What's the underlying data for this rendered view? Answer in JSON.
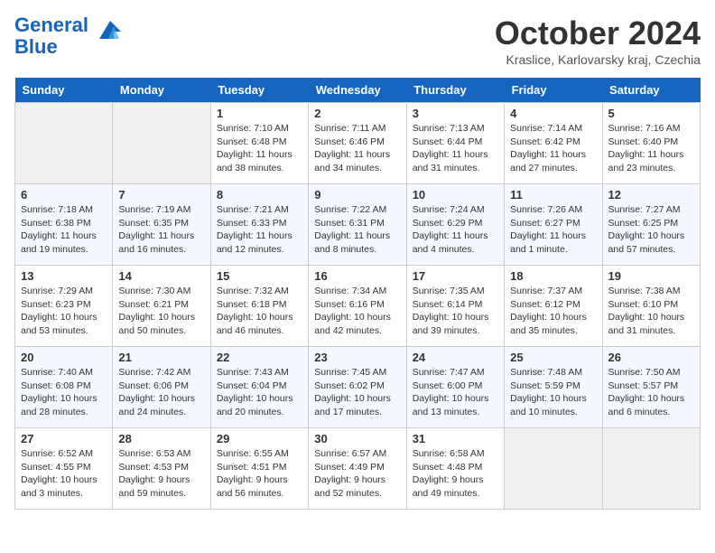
{
  "header": {
    "logo_line1": "General",
    "logo_line2": "Blue",
    "month": "October 2024",
    "location": "Kraslice, Karlovarsky kraj, Czechia"
  },
  "weekdays": [
    "Sunday",
    "Monday",
    "Tuesday",
    "Wednesday",
    "Thursday",
    "Friday",
    "Saturday"
  ],
  "weeks": [
    [
      {
        "day": "",
        "sunrise": "",
        "sunset": "",
        "daylight": ""
      },
      {
        "day": "",
        "sunrise": "",
        "sunset": "",
        "daylight": ""
      },
      {
        "day": "1",
        "sunrise": "Sunrise: 7:10 AM",
        "sunset": "Sunset: 6:48 PM",
        "daylight": "Daylight: 11 hours and 38 minutes."
      },
      {
        "day": "2",
        "sunrise": "Sunrise: 7:11 AM",
        "sunset": "Sunset: 6:46 PM",
        "daylight": "Daylight: 11 hours and 34 minutes."
      },
      {
        "day": "3",
        "sunrise": "Sunrise: 7:13 AM",
        "sunset": "Sunset: 6:44 PM",
        "daylight": "Daylight: 11 hours and 31 minutes."
      },
      {
        "day": "4",
        "sunrise": "Sunrise: 7:14 AM",
        "sunset": "Sunset: 6:42 PM",
        "daylight": "Daylight: 11 hours and 27 minutes."
      },
      {
        "day": "5",
        "sunrise": "Sunrise: 7:16 AM",
        "sunset": "Sunset: 6:40 PM",
        "daylight": "Daylight: 11 hours and 23 minutes."
      }
    ],
    [
      {
        "day": "6",
        "sunrise": "Sunrise: 7:18 AM",
        "sunset": "Sunset: 6:38 PM",
        "daylight": "Daylight: 11 hours and 19 minutes."
      },
      {
        "day": "7",
        "sunrise": "Sunrise: 7:19 AM",
        "sunset": "Sunset: 6:35 PM",
        "daylight": "Daylight: 11 hours and 16 minutes."
      },
      {
        "day": "8",
        "sunrise": "Sunrise: 7:21 AM",
        "sunset": "Sunset: 6:33 PM",
        "daylight": "Daylight: 11 hours and 12 minutes."
      },
      {
        "day": "9",
        "sunrise": "Sunrise: 7:22 AM",
        "sunset": "Sunset: 6:31 PM",
        "daylight": "Daylight: 11 hours and 8 minutes."
      },
      {
        "day": "10",
        "sunrise": "Sunrise: 7:24 AM",
        "sunset": "Sunset: 6:29 PM",
        "daylight": "Daylight: 11 hours and 4 minutes."
      },
      {
        "day": "11",
        "sunrise": "Sunrise: 7:26 AM",
        "sunset": "Sunset: 6:27 PM",
        "daylight": "Daylight: 11 hours and 1 minute."
      },
      {
        "day": "12",
        "sunrise": "Sunrise: 7:27 AM",
        "sunset": "Sunset: 6:25 PM",
        "daylight": "Daylight: 10 hours and 57 minutes."
      }
    ],
    [
      {
        "day": "13",
        "sunrise": "Sunrise: 7:29 AM",
        "sunset": "Sunset: 6:23 PM",
        "daylight": "Daylight: 10 hours and 53 minutes."
      },
      {
        "day": "14",
        "sunrise": "Sunrise: 7:30 AM",
        "sunset": "Sunset: 6:21 PM",
        "daylight": "Daylight: 10 hours and 50 minutes."
      },
      {
        "day": "15",
        "sunrise": "Sunrise: 7:32 AM",
        "sunset": "Sunset: 6:18 PM",
        "daylight": "Daylight: 10 hours and 46 minutes."
      },
      {
        "day": "16",
        "sunrise": "Sunrise: 7:34 AM",
        "sunset": "Sunset: 6:16 PM",
        "daylight": "Daylight: 10 hours and 42 minutes."
      },
      {
        "day": "17",
        "sunrise": "Sunrise: 7:35 AM",
        "sunset": "Sunset: 6:14 PM",
        "daylight": "Daylight: 10 hours and 39 minutes."
      },
      {
        "day": "18",
        "sunrise": "Sunrise: 7:37 AM",
        "sunset": "Sunset: 6:12 PM",
        "daylight": "Daylight: 10 hours and 35 minutes."
      },
      {
        "day": "19",
        "sunrise": "Sunrise: 7:38 AM",
        "sunset": "Sunset: 6:10 PM",
        "daylight": "Daylight: 10 hours and 31 minutes."
      }
    ],
    [
      {
        "day": "20",
        "sunrise": "Sunrise: 7:40 AM",
        "sunset": "Sunset: 6:08 PM",
        "daylight": "Daylight: 10 hours and 28 minutes."
      },
      {
        "day": "21",
        "sunrise": "Sunrise: 7:42 AM",
        "sunset": "Sunset: 6:06 PM",
        "daylight": "Daylight: 10 hours and 24 minutes."
      },
      {
        "day": "22",
        "sunrise": "Sunrise: 7:43 AM",
        "sunset": "Sunset: 6:04 PM",
        "daylight": "Daylight: 10 hours and 20 minutes."
      },
      {
        "day": "23",
        "sunrise": "Sunrise: 7:45 AM",
        "sunset": "Sunset: 6:02 PM",
        "daylight": "Daylight: 10 hours and 17 minutes."
      },
      {
        "day": "24",
        "sunrise": "Sunrise: 7:47 AM",
        "sunset": "Sunset: 6:00 PM",
        "daylight": "Daylight: 10 hours and 13 minutes."
      },
      {
        "day": "25",
        "sunrise": "Sunrise: 7:48 AM",
        "sunset": "Sunset: 5:59 PM",
        "daylight": "Daylight: 10 hours and 10 minutes."
      },
      {
        "day": "26",
        "sunrise": "Sunrise: 7:50 AM",
        "sunset": "Sunset: 5:57 PM",
        "daylight": "Daylight: 10 hours and 6 minutes."
      }
    ],
    [
      {
        "day": "27",
        "sunrise": "Sunrise: 6:52 AM",
        "sunset": "Sunset: 4:55 PM",
        "daylight": "Daylight: 10 hours and 3 minutes."
      },
      {
        "day": "28",
        "sunrise": "Sunrise: 6:53 AM",
        "sunset": "Sunset: 4:53 PM",
        "daylight": "Daylight: 9 hours and 59 minutes."
      },
      {
        "day": "29",
        "sunrise": "Sunrise: 6:55 AM",
        "sunset": "Sunset: 4:51 PM",
        "daylight": "Daylight: 9 hours and 56 minutes."
      },
      {
        "day": "30",
        "sunrise": "Sunrise: 6:57 AM",
        "sunset": "Sunset: 4:49 PM",
        "daylight": "Daylight: 9 hours and 52 minutes."
      },
      {
        "day": "31",
        "sunrise": "Sunrise: 6:58 AM",
        "sunset": "Sunset: 4:48 PM",
        "daylight": "Daylight: 9 hours and 49 minutes."
      },
      {
        "day": "",
        "sunrise": "",
        "sunset": "",
        "daylight": ""
      },
      {
        "day": "",
        "sunrise": "",
        "sunset": "",
        "daylight": ""
      }
    ]
  ]
}
